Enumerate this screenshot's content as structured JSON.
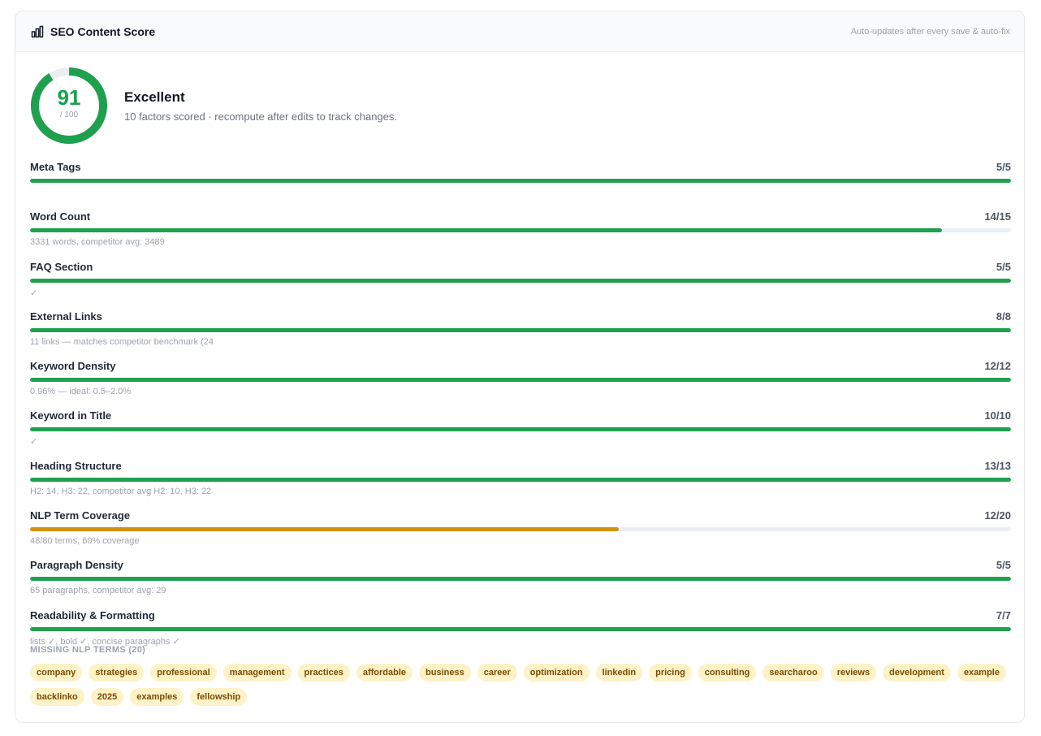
{
  "header": {
    "title": "SEO Content Score",
    "note": "Auto-updates after every save & auto-fix",
    "icon": "bar-chart-icon"
  },
  "score": {
    "value": "91",
    "max_label": "/ 100",
    "fraction": 0.91,
    "grade": "Excellent",
    "subtitle": "10 factors scored · recompute after edits to track changes."
  },
  "colors": {
    "good": "#1fa04f",
    "warn": "#d1930b",
    "track": "#eceff2"
  },
  "factors": [
    {
      "name": "Meta Tags",
      "score": "5/5",
      "fraction": 1.0,
      "status": "good",
      "detail": ""
    },
    {
      "name": "Word Count",
      "score": "14/15",
      "fraction": 0.93,
      "status": "good",
      "detail": "3331 words, competitor avg: 3489"
    },
    {
      "name": "FAQ Section",
      "score": "5/5",
      "fraction": 1.0,
      "status": "good",
      "detail": "✓"
    },
    {
      "name": "External Links",
      "score": "8/8",
      "fraction": 1.0,
      "status": "good",
      "detail": "11 links — matches competitor benchmark (24"
    },
    {
      "name": "Keyword Density",
      "score": "12/12",
      "fraction": 1.0,
      "status": "good",
      "detail": "0.96% — ideal: 0.5–2.0%"
    },
    {
      "name": "Keyword in Title",
      "score": "10/10",
      "fraction": 1.0,
      "status": "good",
      "detail": "✓"
    },
    {
      "name": "Heading Structure",
      "score": "13/13",
      "fraction": 1.0,
      "status": "good",
      "detail": "H2: 14, H3: 22, competitor avg H2: 10, H3: 22"
    },
    {
      "name": "NLP Term Coverage",
      "score": "12/20",
      "fraction": 0.6,
      "status": "warn",
      "detail": "48/80 terms, 60% coverage"
    },
    {
      "name": "Paragraph Density",
      "score": "5/5",
      "fraction": 1.0,
      "status": "good",
      "detail": "65 paragraphs, competitor avg: 29"
    },
    {
      "name": "Readability & Formatting",
      "score": "7/7",
      "fraction": 1.0,
      "status": "good",
      "detail": "lists ✓, bold ✓, concise paragraphs ✓"
    }
  ],
  "missing": {
    "title": "MISSING NLP TERMS (20)",
    "terms": [
      "company",
      "strategies",
      "professional",
      "management",
      "practices",
      "affordable",
      "business",
      "career",
      "optimization",
      "linkedin",
      "pricing",
      "consulting",
      "searcharoo",
      "reviews",
      "development",
      "example",
      "backlinko",
      "2025",
      "examples",
      "fellowship"
    ]
  }
}
